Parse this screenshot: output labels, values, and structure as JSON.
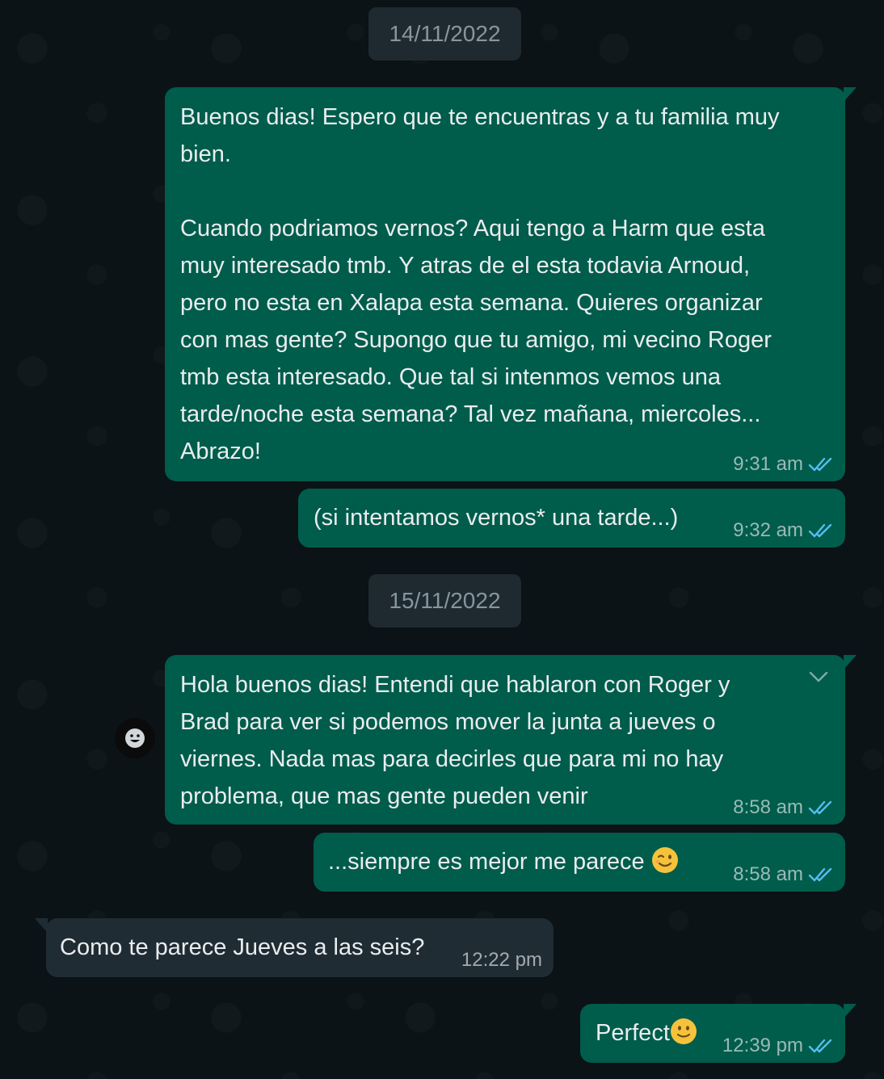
{
  "dates": [
    "14/11/2022",
    "15/11/2022"
  ],
  "messages": [
    {
      "direction": "out",
      "text": "Buenos dias! Espero que te encuentras y a tu familia muy\nbien.\n\nCuando podriamos vernos? Aqui tengo a Harm que esta\nmuy interesado tmb. Y atras de el esta todavia Arnoud,\npero no esta en Xalapa esta semana. Quieres organizar\ncon mas gente? Supongo que tu amigo, mi vecino Roger\ntmb esta interesado. Que tal si intenmos vemos una\ntarde/noche esta semana? Tal vez mañana, miercoles...\nAbrazo!",
      "time": "9:31 am",
      "status": "read"
    },
    {
      "direction": "out",
      "text": "(si intentamos vernos* una tarde...)",
      "time": "9:32 am",
      "status": "read"
    },
    {
      "direction": "out",
      "text": "Hola buenos dias! Entendi que hablaron con Roger y\nBrad para ver si podemos mover la junta a jueves o\nviernes. Nada mas para decirles que para mi no hay\nproblema, que mas gente pueden venir",
      "time": "8:58 am",
      "status": "read"
    },
    {
      "direction": "out",
      "text": "...siempre es mejor me parece",
      "emoji": "winking-face",
      "time": "8:58 am",
      "status": "read"
    },
    {
      "direction": "in",
      "text": "Como te parece Jueves a las seis?",
      "time": "12:22 pm"
    },
    {
      "direction": "out",
      "text": "Perfect",
      "emoji": "slightly-smiling-face",
      "time": "12:39 pm",
      "status": "read"
    }
  ],
  "icons": {
    "read_ticks": "double-check-icon",
    "menu": "chevron-down-icon",
    "reaction": "emoji-reaction-icon"
  },
  "colors": {
    "background": "#0c1317",
    "outgoing_bubble": "#005c4b",
    "incoming_bubble": "#202c33",
    "date_chip": "#1f2a30",
    "read_tick": "#53bdeb"
  }
}
